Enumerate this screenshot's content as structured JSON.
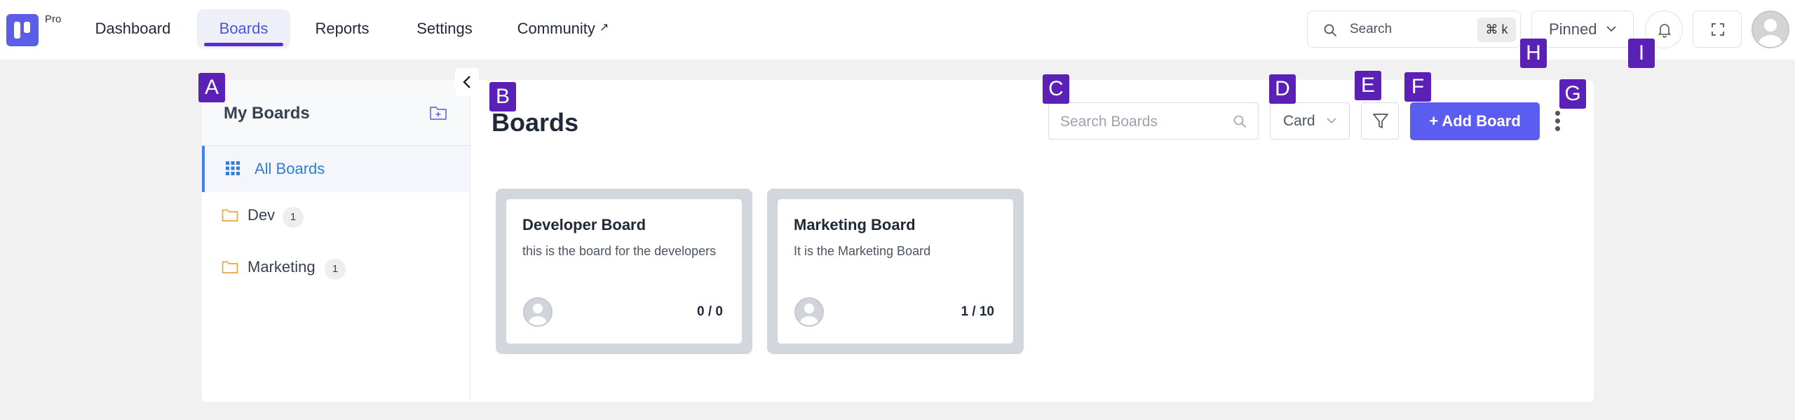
{
  "brand": {
    "badge": "Pro",
    "accent": "#5b5fe8"
  },
  "nav": {
    "items": [
      {
        "label": "Dashboard",
        "active": false
      },
      {
        "label": "Boards",
        "active": true
      },
      {
        "label": "Reports",
        "active": false
      },
      {
        "label": "Settings",
        "active": false
      },
      {
        "label": "Community",
        "active": false,
        "external_icon": "external-link-icon",
        "external_glyph": "↗"
      }
    ]
  },
  "search": {
    "label": "Search",
    "shortcut": "⌘ k",
    "icon": "search-icon"
  },
  "pinned": {
    "label": "Pinned",
    "icon": "chevron-down-icon"
  },
  "topbar_icons": [
    "bell-icon",
    "fullscreen-icon",
    "user-avatar"
  ],
  "sidebar": {
    "title": "My Boards",
    "add_icon": "folder-add-icon",
    "all_boards": {
      "label": "All Boards",
      "icon": "grid-icon",
      "active": true
    },
    "folders": [
      {
        "label": "Dev",
        "count": "1",
        "icon": "folder-icon"
      },
      {
        "label": "Marketing",
        "count": "1",
        "icon": "folder-icon"
      }
    ],
    "collapse_icon": "chevron-left-icon"
  },
  "main": {
    "title": "Boards",
    "search_placeholder": "Search Boards",
    "view_select": {
      "value": "Card"
    },
    "filter_icon": "filter-icon",
    "add_button": {
      "label": "+ Add Board",
      "color": "#5b5cf0"
    },
    "more_icon": "more-vertical-icon"
  },
  "boards": [
    {
      "name": "Developer Board",
      "description": "this is the board for the developers",
      "progress": "0 / 0"
    },
    {
      "name": "Marketing Board",
      "description": "It is the Marketing Board",
      "progress": "1 / 10"
    }
  ],
  "markers": [
    "A",
    "B",
    "C",
    "D",
    "E",
    "F",
    "G",
    "H",
    "I"
  ],
  "marker_color": "#5b21b6"
}
